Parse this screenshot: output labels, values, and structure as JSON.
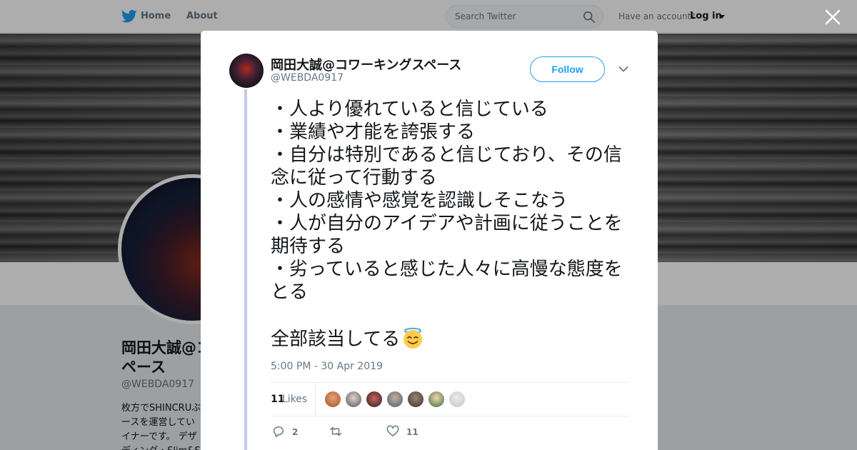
{
  "nav": {
    "home_label": "Home",
    "about_label": "About",
    "search_placeholder": "Search Twitter",
    "account_question": "Have an account?",
    "login_label": "Log in"
  },
  "profile": {
    "name": "岡田大誠@コ",
    "name_line2": "ペース",
    "handle": "@WEBDA0917",
    "bio": "枚方でSHINCRUぶ\nースを運営してい\nイナーです。 デザ\nディング・Slim&S"
  },
  "tweet": {
    "author_name": "岡田大誠@コワーキングスペース",
    "author_handle": "@WEBDA0917",
    "follow_label": "Follow",
    "text": "・人より優れていると信じている\n・業績や才能を誇張する\n・自分は特別であると信じており、その信念に従って行動する\n・人の感情や感覚を認識しそこなう\n・人が自分のアイデアや計画に従うことを期待する\n・劣っていると感じた人々に高慢な態度をとる\n\n全部該当してる",
    "emoji": "smiling-face-with-halo",
    "timestamp": "5:00 PM - 30 Apr 2019",
    "likes_count": "11",
    "likes_label": "Likes",
    "reply_count": "2",
    "like_count": "11"
  },
  "colors": {
    "accent": "#1da1f2",
    "muted": "#657786",
    "thread_line": "#c4c8f0"
  }
}
